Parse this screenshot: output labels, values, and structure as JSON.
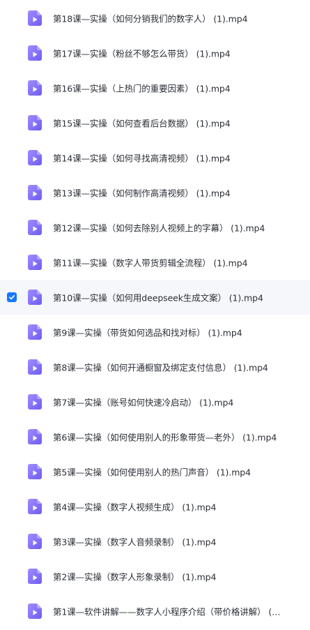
{
  "files": [
    {
      "name": "第18课—实操（如何分销我们的数字人） (1).mp4",
      "selected": false
    },
    {
      "name": "第17课—实操（粉丝不够怎么带货） (1).mp4",
      "selected": false
    },
    {
      "name": "第16课—实操（上热门的重要因素） (1).mp4",
      "selected": false
    },
    {
      "name": "第15课—实操（如何查看后台数据） (1).mp4",
      "selected": false
    },
    {
      "name": "第14课—实操（如何寻找高清视频） (1).mp4",
      "selected": false
    },
    {
      "name": "第13课—实操（如何制作高清视频） (1).mp4",
      "selected": false
    },
    {
      "name": "第12课—实操（如何去除别人视频上的字幕） (1).mp4",
      "selected": false
    },
    {
      "name": "第11课—实操（数字人带货剪辑全流程） (1).mp4",
      "selected": false
    },
    {
      "name": "第10课—实操（如何用deepseek生成文案） (1).mp4",
      "selected": true
    },
    {
      "name": "第9课—实操（带货如何选品和找对标） (1).mp4",
      "selected": false
    },
    {
      "name": "第8课—实操（如何开通橱窗及绑定支付信息） (1).mp4",
      "selected": false
    },
    {
      "name": "第7课—实操（账号如何快速冷启动） (1).mp4",
      "selected": false
    },
    {
      "name": "第6课—实操（如何使用别人的形象带货—老外） (1).mp4",
      "selected": false
    },
    {
      "name": "第5课—实操（如何使用别人的热门声音） (1).mp4",
      "selected": false
    },
    {
      "name": "第4课—实操（数字人视频生成） (1).mp4",
      "selected": false
    },
    {
      "name": "第3课—实操（数字人音频录制） (1).mp4",
      "selected": false
    },
    {
      "name": "第2课—实操（数字人形象录制） (1).mp4",
      "selected": false
    },
    {
      "name": "第1课—软件讲解——数字人小程序介绍（带价格讲解） (1)...",
      "selected": false
    }
  ],
  "colors": {
    "icon_gradient_start": "#a08cff",
    "icon_gradient_end": "#6d5cf2",
    "checkbox": "#1677ff",
    "selected_row_bg": "#f6f7fa"
  },
  "icons": {
    "file": "video-file-icon",
    "checkbox": "checkmark-icon"
  }
}
